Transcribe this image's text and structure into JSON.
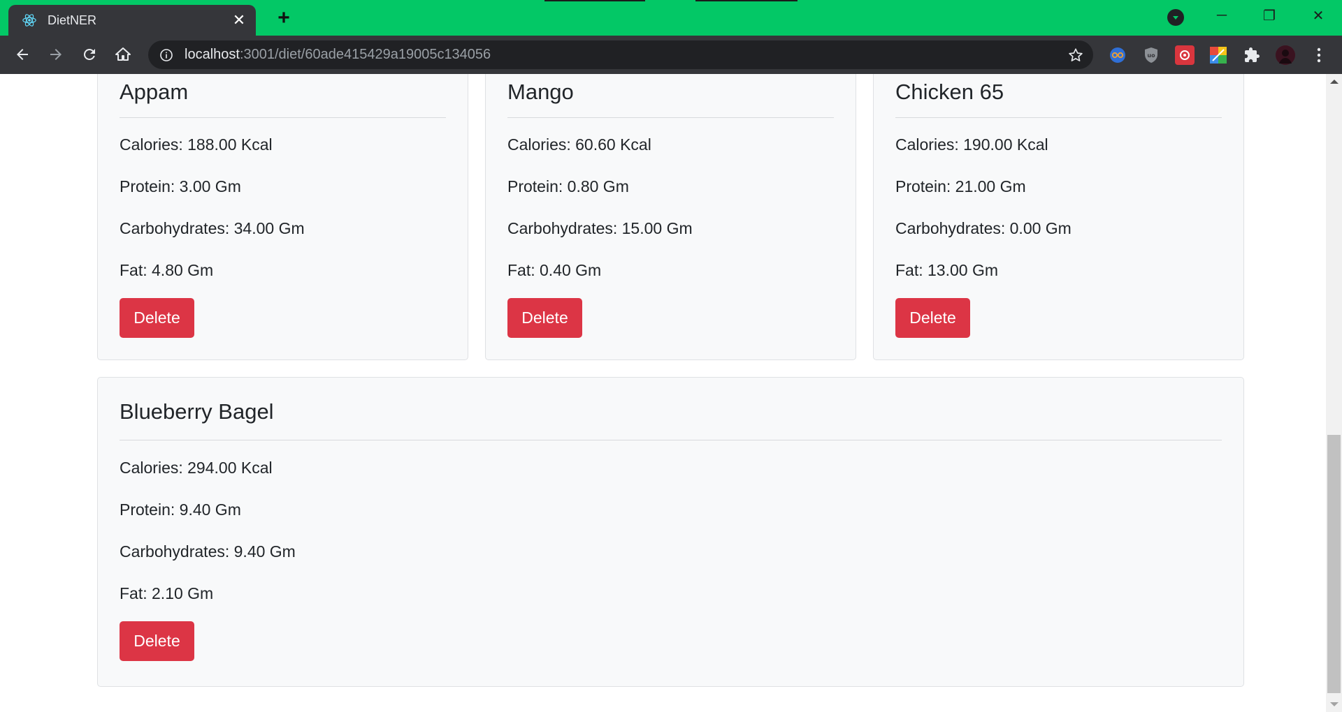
{
  "browser": {
    "tab_title": "DietNER",
    "tab_close": "✕",
    "new_tab": "+",
    "url_host": "localhost",
    "url_path": ":3001/diet/60ade415429a19005c134056",
    "window_controls": {
      "minimize": "─",
      "restore": "❐",
      "close": "✕"
    }
  },
  "foods": [
    {
      "name": "Appam",
      "calories": "Calories: 188.00 Kcal",
      "protein": "Protein: 3.00 Gm",
      "carbs": "Carbohydrates: 34.00 Gm",
      "fat": "Fat: 4.80 Gm",
      "delete_label": "Delete"
    },
    {
      "name": "Mango",
      "calories": "Calories: 60.60 Kcal",
      "protein": "Protein: 0.80 Gm",
      "carbs": "Carbohydrates: 15.00 Gm",
      "fat": "Fat: 0.40 Gm",
      "delete_label": "Delete"
    },
    {
      "name": "Chicken 65",
      "calories": "Calories: 190.00 Kcal",
      "protein": "Protein: 21.00 Gm",
      "carbs": "Carbohydrates: 0.00 Gm",
      "fat": "Fat: 13.00 Gm",
      "delete_label": "Delete"
    },
    {
      "name": "Blueberry Bagel",
      "calories": "Calories: 294.00 Kcal",
      "protein": "Protein: 9.40 Gm",
      "carbs": "Carbohydrates: 9.40 Gm",
      "fat": "Fat: 2.10 Gm",
      "delete_label": "Delete"
    }
  ],
  "colors": {
    "titlebar": "#03c866",
    "delete_button": "#dc3545",
    "card_bg": "#f8f9fa"
  }
}
